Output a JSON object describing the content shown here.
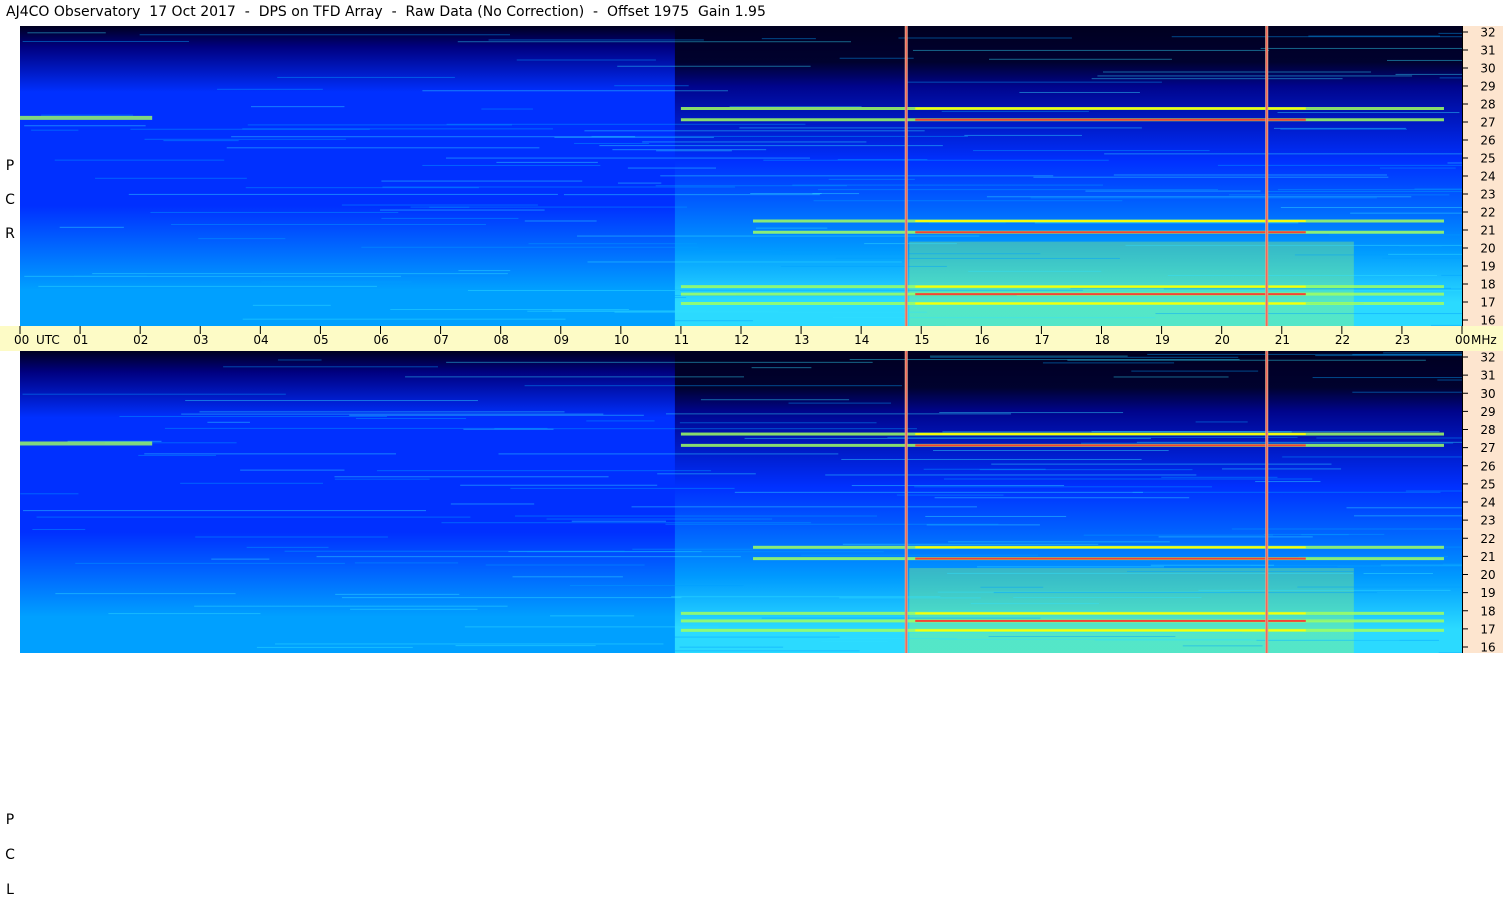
{
  "title": "AJ4CO Observatory  17 Oct 2017  -  DPS on TFD Array  -  Raw Data (No Correction)  -  Offset 1975  Gain 1.95",
  "chart_data": {
    "type": "heatmap",
    "title": "AJ4CO Observatory  17 Oct 2017  -  DPS on TFD Array  -  Raw Data (No Correction)  -  Offset 1975  Gain 1.95",
    "xlabel": "UTC",
    "ylabel": "MHz",
    "x_ticks": [
      "00",
      "01",
      "02",
      "03",
      "04",
      "05",
      "06",
      "07",
      "08",
      "09",
      "10",
      "11",
      "12",
      "13",
      "14",
      "15",
      "16",
      "17",
      "18",
      "19",
      "20",
      "21",
      "22",
      "23",
      "00"
    ],
    "x_range_hours": [
      0,
      24
    ],
    "y_ticks": [
      "16",
      "17",
      "18",
      "19",
      "20",
      "21",
      "22",
      "23",
      "24",
      "25",
      "26",
      "27",
      "28",
      "29",
      "30",
      "31",
      "32"
    ],
    "ylim": [
      16,
      32
    ],
    "panels": [
      {
        "name": "R C P",
        "polarization": [
          "R",
          "C",
          "P"
        ]
      },
      {
        "name": "L C P",
        "polarization": [
          "L",
          "C",
          "P"
        ]
      }
    ],
    "colormap": [
      "#000020",
      "#000080",
      "#0030ff",
      "#00a0ff",
      "#30e0ff",
      "#a0ff60",
      "#ffff00",
      "#ff3030",
      "#ff60ff"
    ],
    "bright_bands_mhz": [
      17.2,
      17.7,
      18.1,
      21.0,
      21.6,
      27.0,
      27.6
    ],
    "vertical_lines_utc": [
      14.75,
      20.75
    ]
  }
}
